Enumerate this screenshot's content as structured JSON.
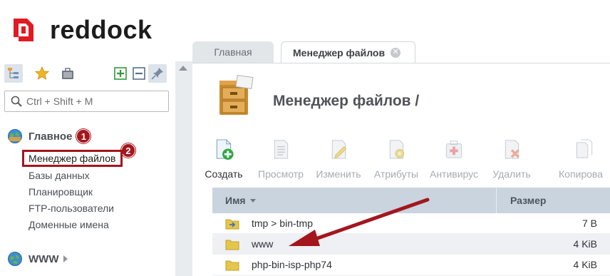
{
  "brand": {
    "name": "reddock",
    "color": "#e01b24"
  },
  "sidebar": {
    "search_placeholder": "Ctrl + Shift + M",
    "groups": [
      {
        "title": "Главное",
        "badge": "1"
      },
      {
        "title": "WWW"
      }
    ],
    "items": [
      {
        "label": "Менеджер файлов",
        "badge": "2",
        "highlighted": true
      },
      {
        "label": "Базы данных"
      },
      {
        "label": "Планировщик"
      },
      {
        "label": "FTP-пользователи"
      },
      {
        "label": "Доменные имена"
      }
    ],
    "toolbar_icons": [
      "tree-icon",
      "star-icon",
      "briefcase-icon",
      "expand-all-icon",
      "collapse-all-icon",
      "pin-icon"
    ]
  },
  "tabs": [
    {
      "label": "Главная",
      "active": false
    },
    {
      "label": "Менеджер файлов",
      "active": true
    }
  ],
  "main": {
    "title": "Менеджер файлов /",
    "toolbar": [
      {
        "label": "Создать",
        "enabled": true,
        "icon": "create-file-icon"
      },
      {
        "label": "Просмотр",
        "enabled": false,
        "icon": "view-icon"
      },
      {
        "label": "Изменить",
        "enabled": false,
        "icon": "edit-icon"
      },
      {
        "label": "Атрибуты",
        "enabled": false,
        "icon": "attributes-icon"
      },
      {
        "label": "Антивирус",
        "enabled": false,
        "icon": "antivirus-icon"
      },
      {
        "label": "Удалить",
        "enabled": false,
        "icon": "delete-icon"
      },
      {
        "label": "Копирова",
        "enabled": false,
        "icon": "copy-icon"
      }
    ],
    "table": {
      "columns": [
        "Имя",
        "Размер"
      ],
      "rows": [
        {
          "name": "tmp > bin-tmp",
          "size": "7 B",
          "type": "symlink"
        },
        {
          "name": "www",
          "size": "4 KiB",
          "type": "folder"
        },
        {
          "name": "php-bin-isp-php74",
          "size": "4 KiB",
          "type": "folder"
        }
      ]
    }
  },
  "colors": {
    "accent_red": "#a3161d",
    "header_blue": "#c9d4df"
  }
}
